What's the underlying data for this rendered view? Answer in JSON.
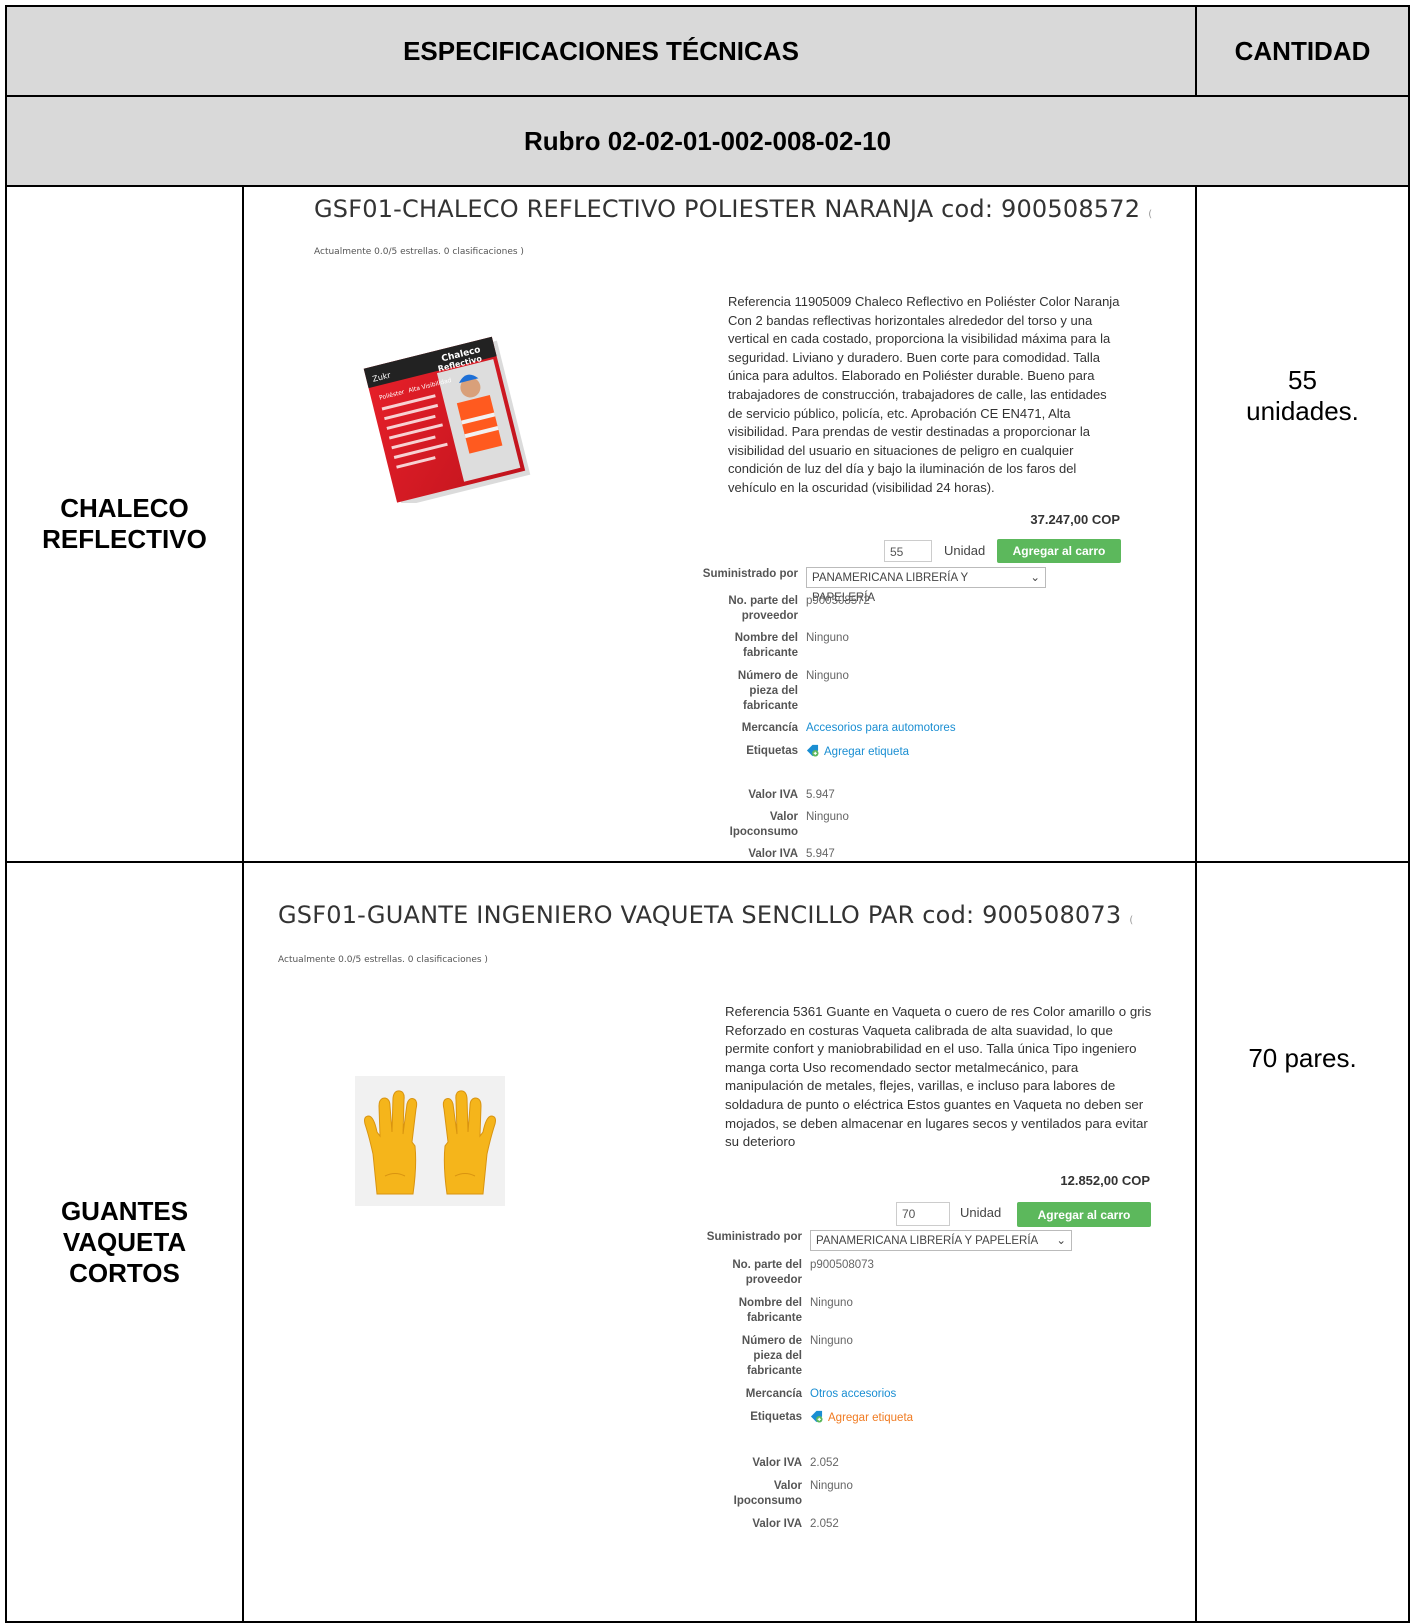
{
  "header": {
    "spec_title": "ESPECIFICACIONES TÉCNICAS",
    "qty_title": "CANTIDAD",
    "rubro": "Rubro 02-02-01-002-008-02-10"
  },
  "items": [
    {
      "name_lines": [
        "CHALECO",
        "REFLECTIVO"
      ],
      "quantity_lines": [
        "55",
        "unidades."
      ],
      "product": {
        "title": "GSF01-CHALECO REFLECTIVO POLIESTER NARANJA cod: 900508572",
        "title_suffix": "(",
        "rating": "Actualmente 0.0/5 estrellas. 0 clasificaciones )",
        "description": "Referencia 11905009 Chaleco Reflectivo en Poliéster Color Naranja Con 2 bandas reflectivas horizontales alrededor del torso y una vertical en cada costado, proporciona la visibilidad máxima para la seguridad. Liviano y duradero. Buen corte para comodidad. Talla única para adultos. Elaborado en Poliéster durable. Bueno para trabajadores de construcción, trabajadores de calle, las entidades de servicio público, policía, etc. Aprobación CE EN471, Alta visibilidad. Para prendas de vestir destinadas a proporcionar la visibilidad del usuario en situaciones de peligro en cualquier condición de luz del día y bajo la iluminación de los faros del vehículo en la oscuridad (visibilidad 24 horas).",
        "price": "37.247,00 COP",
        "qty_value": "55",
        "unit_label": "Unidad",
        "cart_button": "Agregar al carro",
        "fields": {
          "supplier_label": "Suministrado por",
          "supplier_value": "PANAMERICANA LIBRERÍA Y PAPELERÍA",
          "part_label": "No. parte del proveedor",
          "part_value": "p900508572",
          "maker_label_1": "Nombre del",
          "maker_label_2": "fabricante",
          "maker_value": "Ninguno",
          "piece_label_1": "Número de",
          "piece_label_2": "pieza del",
          "piece_label_3": "fabricante",
          "piece_value": "Ninguno",
          "merch_label": "Mercancía",
          "merch_value": "Accesorios para automotores",
          "tags_label": "Etiquetas",
          "tags_value": "Agregar etiqueta",
          "iva_label": "Valor IVA",
          "iva_value": "5.947",
          "ipo_label_1": "Valor",
          "ipo_label_2": "Ipoconsumo",
          "ipo_value": "Ninguno",
          "iva2_label": "Valor IVA",
          "iva2_value": "5.947"
        }
      }
    },
    {
      "name_lines": [
        "GUANTES",
        "VAQUETA",
        "CORTOS"
      ],
      "quantity_lines": [
        "70 pares."
      ],
      "product": {
        "title": "GSF01-GUANTE INGENIERO VAQUETA SENCILLO PAR cod: 900508073",
        "title_suffix": "(",
        "rating": "Actualmente 0.0/5 estrellas. 0 clasificaciones )",
        "description": "Referencia 5361 Guante en Vaqueta o cuero de res Color amarillo o gris Reforzado en costuras Vaqueta calibrada de alta suavidad, lo que permite confort y maniobrabilidad en el uso. Talla única Tipo ingeniero manga corta Uso recomendado sector metalmecánico, para manipulación de metales, flejes, varillas, e incluso para labores de soldadura de punto o eléctrica Estos guantes en Vaqueta no deben ser mojados, se deben almacenar en lugares secos y ventilados para evitar su deterioro",
        "price": "12.852,00 COP",
        "qty_value": "70",
        "unit_label": "Unidad",
        "cart_button": "Agregar al carro",
        "fields": {
          "supplier_label": "Suministrado por",
          "supplier_value": "PANAMERICANA LIBRERÍA Y PAPELERÍA",
          "part_label": "No. parte del proveedor",
          "part_value": "p900508073",
          "maker_label_1": "Nombre del",
          "maker_label_2": "fabricante",
          "maker_value": "Ninguno",
          "piece_label_1": "Número de",
          "piece_label_2": "pieza del",
          "piece_label_3": "fabricante",
          "piece_value": "Ninguno",
          "merch_label": "Mercancía",
          "merch_value": "Otros accesorios",
          "tags_label": "Etiquetas",
          "tags_value": "Agregar etiqueta",
          "iva_label": "Valor IVA",
          "iva_value": "2.052",
          "ipo_label_1": "Valor",
          "ipo_label_2": "Ipoconsumo",
          "ipo_value": "Ninguno",
          "iva2_label": "Valor IVA",
          "iva2_value": "2.052"
        }
      }
    }
  ],
  "images": {
    "vest_cover_text": [
      "Chaleco",
      "Reflectivo",
      "Poliéster",
      "Alta Visibilidad"
    ],
    "vest_brand": "Zukr"
  }
}
